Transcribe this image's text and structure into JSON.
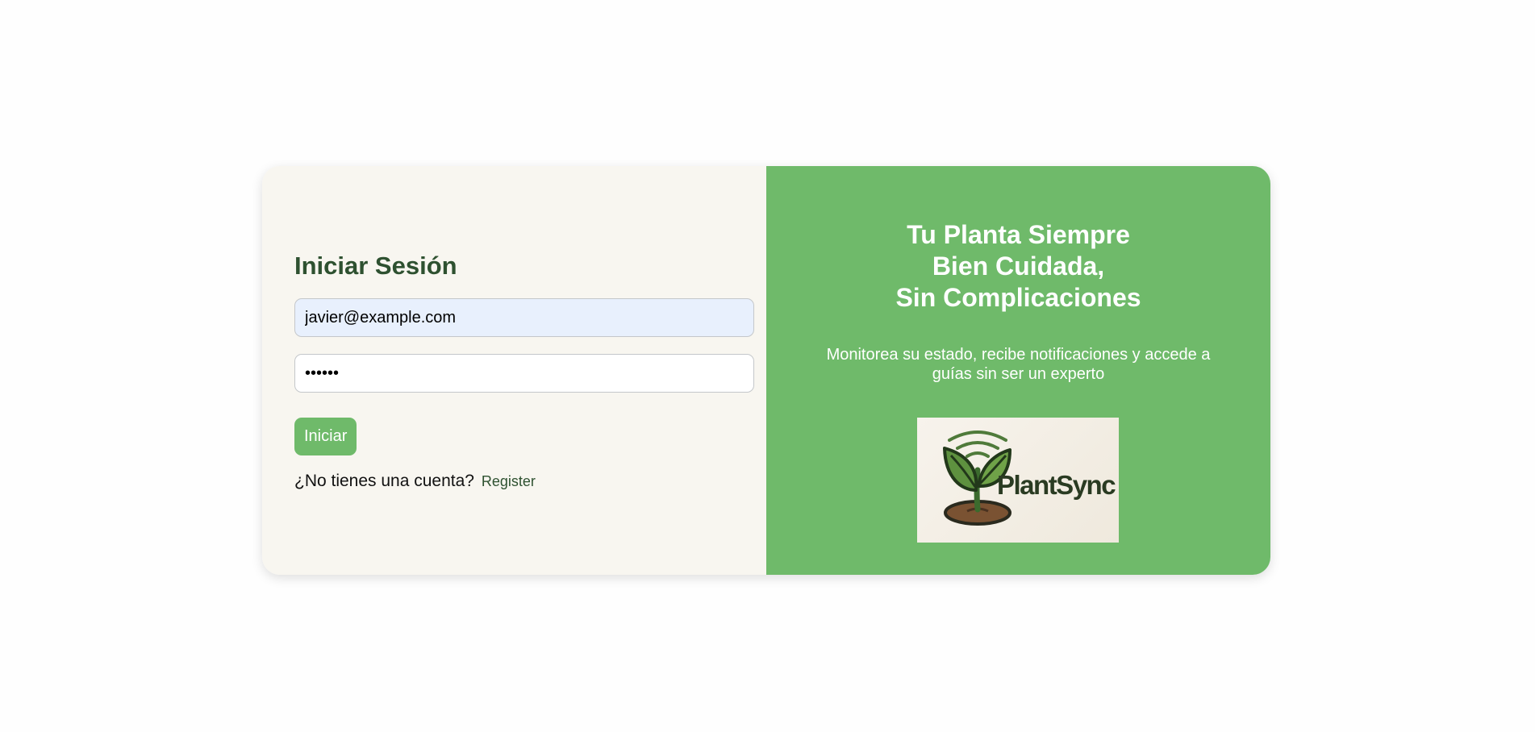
{
  "login": {
    "title": "Iniciar Sesión",
    "email_value": "javier@example.com",
    "password_value": "123456",
    "submit_label": "Iniciar",
    "no_account_text": "¿No tienes una cuenta?",
    "register_label": "Register"
  },
  "promo": {
    "headline_lines": [
      "Tu Planta Siempre",
      "Bien Cuidada,",
      "Sin Complicaciones"
    ],
    "subtitle": "Monitorea su estado, recibe notificaciones y accede a guías sin ser un experto",
    "logo_text": "PlantSync",
    "logo_icon": "sprout-wifi-icon"
  },
  "colors": {
    "brand_green": "#6fba6a",
    "dark_green": "#2e5130",
    "panel_bg": "#f8f6f0",
    "email_autofill_bg": "#e8f0fd"
  }
}
